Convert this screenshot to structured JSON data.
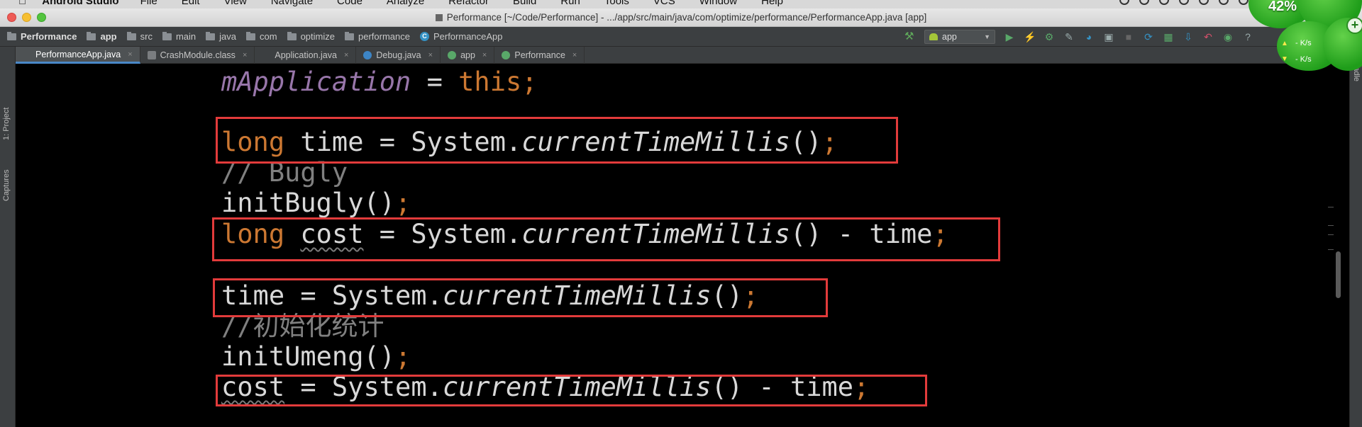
{
  "menubar": {
    "apple": "",
    "app_name": "Android Studio",
    "items": [
      "File",
      "Edit",
      "View",
      "Navigate",
      "Code",
      "Analyze",
      "Refactor",
      "Build",
      "Run",
      "Tools",
      "VCS",
      "Window",
      "Help"
    ]
  },
  "window": {
    "title": "Performance [~/Code/Performance] - .../app/src/main/java/com/optimize/performance/PerformanceApp.java [app]"
  },
  "breadcrumbs": [
    {
      "label": "Performance",
      "icon": "folder-icon",
      "bold": true
    },
    {
      "label": "app",
      "icon": "folder-icon",
      "bold": true
    },
    {
      "label": "src",
      "icon": "folder-icon"
    },
    {
      "label": "main",
      "icon": "folder-icon"
    },
    {
      "label": "java",
      "icon": "folder-icon"
    },
    {
      "label": "com",
      "icon": "package-icon"
    },
    {
      "label": "optimize",
      "icon": "package-icon"
    },
    {
      "label": "performance",
      "icon": "package-icon"
    },
    {
      "label": "PerformanceApp",
      "icon": "class-icon"
    }
  ],
  "toolbar": {
    "run_config": "app"
  },
  "tabs": [
    {
      "label": "PerformanceApp.java",
      "icon": "class",
      "active": true
    },
    {
      "label": "CrashModule.class",
      "icon": "clsfile"
    },
    {
      "label": "Application.java",
      "icon": "class"
    },
    {
      "label": "Debug.java",
      "icon": "blue"
    },
    {
      "label": "app",
      "icon": "gradle"
    },
    {
      "label": "Performance",
      "icon": "gradle"
    }
  ],
  "side_panels": {
    "project": "1: Project",
    "captures": "Captures",
    "gradle": "Gradle"
  },
  "code": {
    "line1": {
      "field": "mApplication",
      "op": " = ",
      "kw": "this",
      "semi": ";"
    },
    "line2": {
      "kw": "long",
      "rest": " time = System.",
      "method": "currentTimeMillis",
      "call": "()",
      "semi": ";"
    },
    "line3": {
      "comment": "// Bugly"
    },
    "line4": {
      "text": "initBugly()",
      "semi": ";"
    },
    "line5": {
      "kw": "long",
      "sp": " ",
      "var": "cost",
      "rest": " = System.",
      "method": "currentTimeMillis",
      "tail": "() - time",
      "semi": ";"
    },
    "line6": {
      "rest": "time = System.",
      "method": "currentTimeMillis",
      "call": "()",
      "semi": ";"
    },
    "line7": {
      "comment": "//初始化统计"
    },
    "line8": {
      "text": "initUmeng()",
      "semi": ";"
    },
    "line9": {
      "var": "cost",
      "rest": " = System.",
      "method": "currentTimeMillis",
      "tail": "() - time",
      "semi": ";"
    }
  },
  "widget": {
    "battery": "42%",
    "upload": "- K/s",
    "download": "- K/s"
  },
  "colors": {
    "keyword": "#cc7832",
    "field": "#9876aa",
    "comment": "#808080",
    "highlight_box": "#e23b3b"
  }
}
